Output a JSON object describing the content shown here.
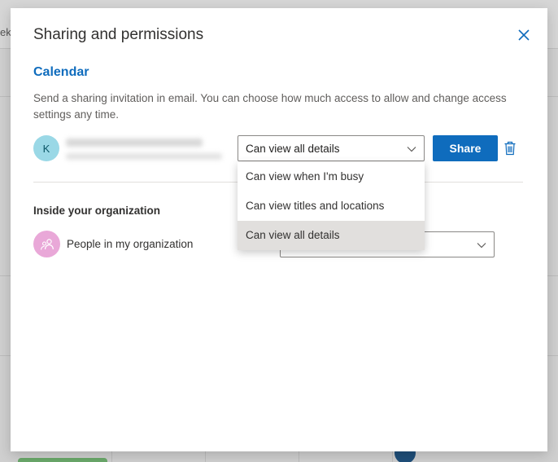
{
  "background": {
    "week_fragment": "ek"
  },
  "dialog": {
    "title": "Sharing and permissions",
    "close_icon": "close-icon"
  },
  "calendar_section": {
    "heading": "Calendar",
    "description": "Send a sharing invitation in email. You can choose how much access to allow and change access settings any time.",
    "invitee": {
      "avatar_initial": "K"
    },
    "permission_select": {
      "value": "Can view all details",
      "options": [
        {
          "label": "Can view when I'm busy"
        },
        {
          "label": "Can view titles and locations"
        },
        {
          "label": "Can view all details",
          "selected": true
        }
      ]
    },
    "share_label": "Share",
    "delete_icon": "trash-icon"
  },
  "organization_section": {
    "heading": "Inside your organization",
    "people_label": "People in my organization",
    "people_icon": "people-icon"
  },
  "colors": {
    "accent": "#0f6cbd",
    "invitee_avatar": "#9ad8e6",
    "org_avatar": "#e9a8d8",
    "selected_option": "#e1dfdd"
  }
}
